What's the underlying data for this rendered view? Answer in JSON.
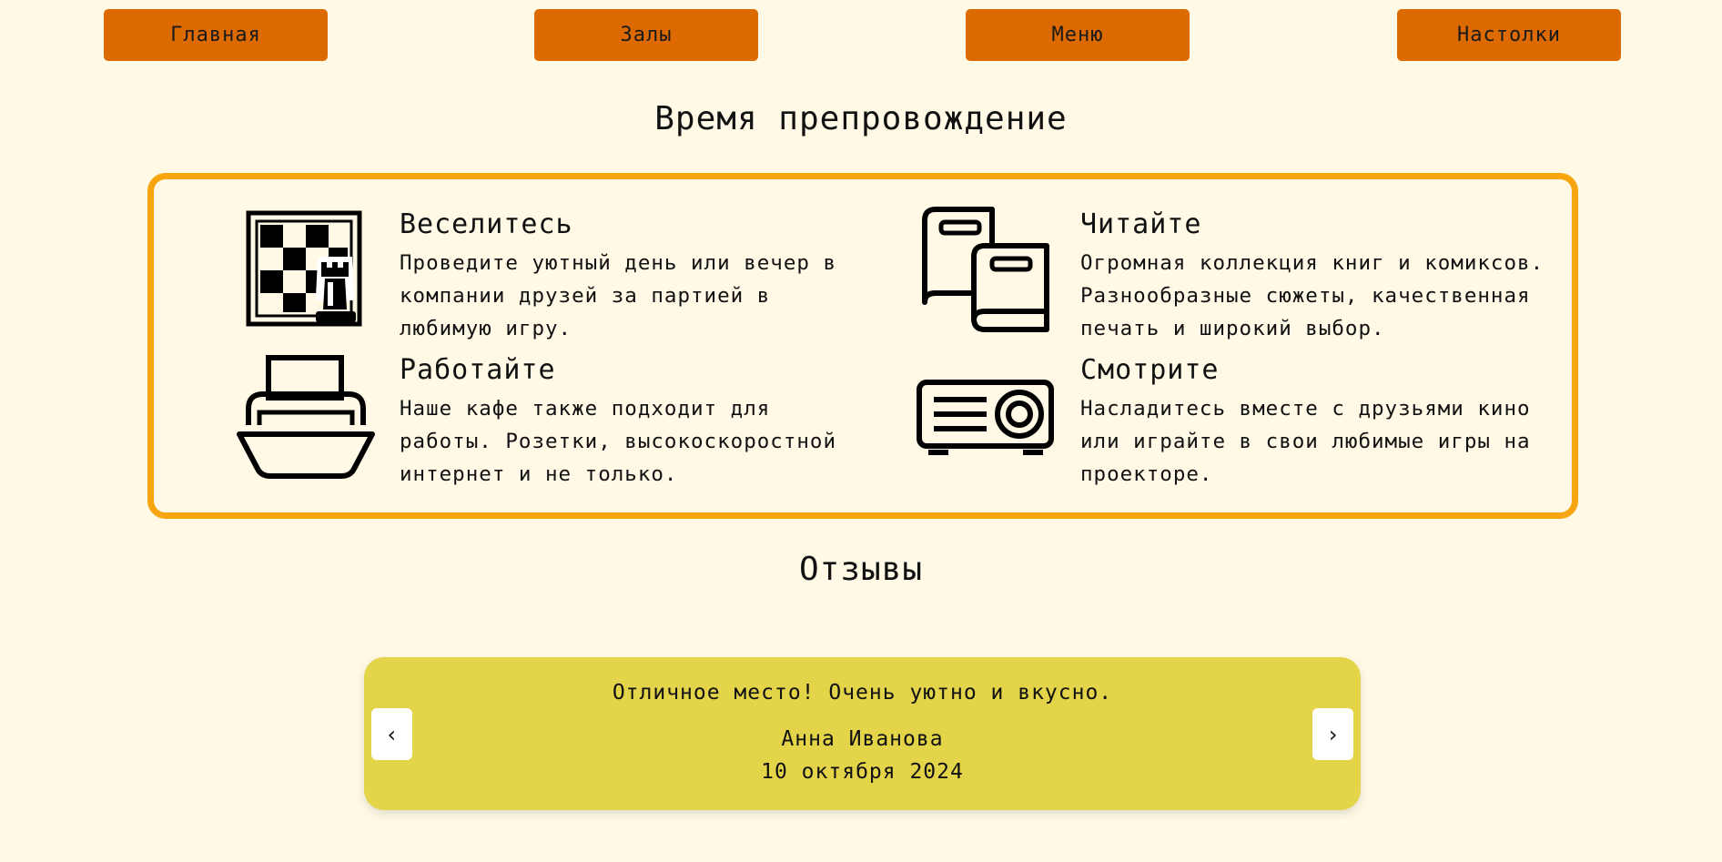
{
  "nav": {
    "items": [
      {
        "label": "Главная"
      },
      {
        "label": "Залы"
      },
      {
        "label": "Меню"
      },
      {
        "label": "Настолки"
      }
    ]
  },
  "pastime": {
    "title": "Время препровождение",
    "features": [
      {
        "icon": "chess-board-icon",
        "title": "Веселитесь",
        "lines": [
          "Проведите уютный день или вечер в",
          "компании друзей за партией в",
          "любимую игру."
        ]
      },
      {
        "icon": "books-icon",
        "title": "Читайте",
        "lines": [
          "Огромная коллекция книг и комиксов.",
          "Разнообразные сюжеты, качественная",
          "печать и широкий выбор."
        ]
      },
      {
        "icon": "printer-icon",
        "title": "Работайте",
        "lines": [
          "Наше кафе также подходит для",
          "работы. Розетки, высокоскоростной",
          "интернет и не только."
        ]
      },
      {
        "icon": "projector-icon",
        "title": "Смотрите",
        "lines": [
          "Насладитесь вместе с друзьями кино",
          "или играйте в свои любимые игры на",
          "проекторе."
        ]
      }
    ]
  },
  "reviews": {
    "title": "Отзывы",
    "current": {
      "text": "Отличное место! Очень уютно и вкусно.",
      "author": "Анна Иванова",
      "date": "10 октября 2024"
    },
    "prev_label": "‹",
    "next_label": "›"
  },
  "colors": {
    "background": "#fff9e6",
    "nav_button": "#dd6a00",
    "features_border": "#f7a50c",
    "review_card": "#e3d44a"
  }
}
